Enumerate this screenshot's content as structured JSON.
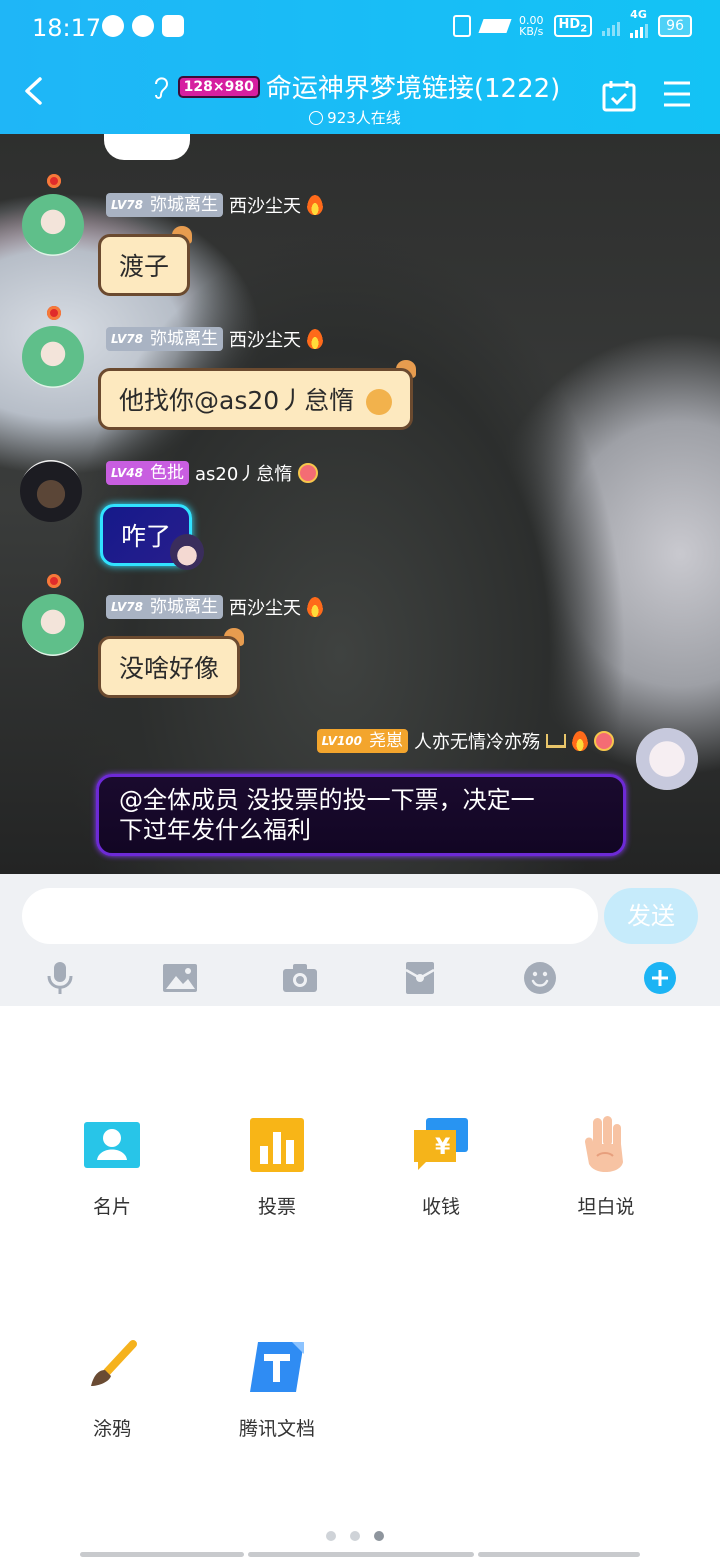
{
  "status_bar": {
    "time": "18:17",
    "net_speed_value": "0.00",
    "net_speed_unit": "KB/s",
    "hd": "HD",
    "hd_sub": "2",
    "network": "4G",
    "battery": "96"
  },
  "header": {
    "group_logo": "128×980",
    "title": "命运神界梦境链接(1222)",
    "online": "923人在线"
  },
  "messages": [
    {
      "level": "LV78",
      "title_tag": "弥城离生",
      "nickname": "西沙尘天",
      "text": "渡子"
    },
    {
      "level": "LV78",
      "title_tag": "弥城离生",
      "nickname": "西沙尘天",
      "text": "他找你@as20丿怠惰"
    },
    {
      "level": "LV48",
      "title_tag": "色批",
      "nickname": "as20丿怠惰",
      "text": "咋了"
    },
    {
      "level": "LV78",
      "title_tag": "弥城离生",
      "nickname": "西沙尘天",
      "text": "没啥好像"
    },
    {
      "level": "LV100",
      "title_tag": "尧崽",
      "nickname": "人亦无情冷亦殇",
      "text_line1": "@全体成员 没投票的投一下票，决定一",
      "text_line2": "下过年发什么福利"
    }
  ],
  "input": {
    "placeholder": "",
    "send_label": "发送"
  },
  "toolbar_icons": [
    "microphone-icon",
    "image-icon",
    "camera-icon",
    "red-packet-icon",
    "emoji-icon",
    "plus-icon"
  ],
  "panel": {
    "items": [
      {
        "label": "名片",
        "icon": "contact-card-icon"
      },
      {
        "label": "投票",
        "icon": "vote-chart-icon"
      },
      {
        "label": "收钱",
        "icon": "collect-money-icon"
      },
      {
        "label": "坦白说",
        "icon": "hand-icon"
      },
      {
        "label": "涂鸦",
        "icon": "paintbrush-icon"
      },
      {
        "label": "腾讯文档",
        "icon": "tencent-docs-icon"
      }
    ],
    "page_count": 3,
    "active_page": 3
  },
  "colors": {
    "header": "#1fb6f7",
    "send_button": "#c6ebfb",
    "plus_icon": "#1cb4f4"
  }
}
